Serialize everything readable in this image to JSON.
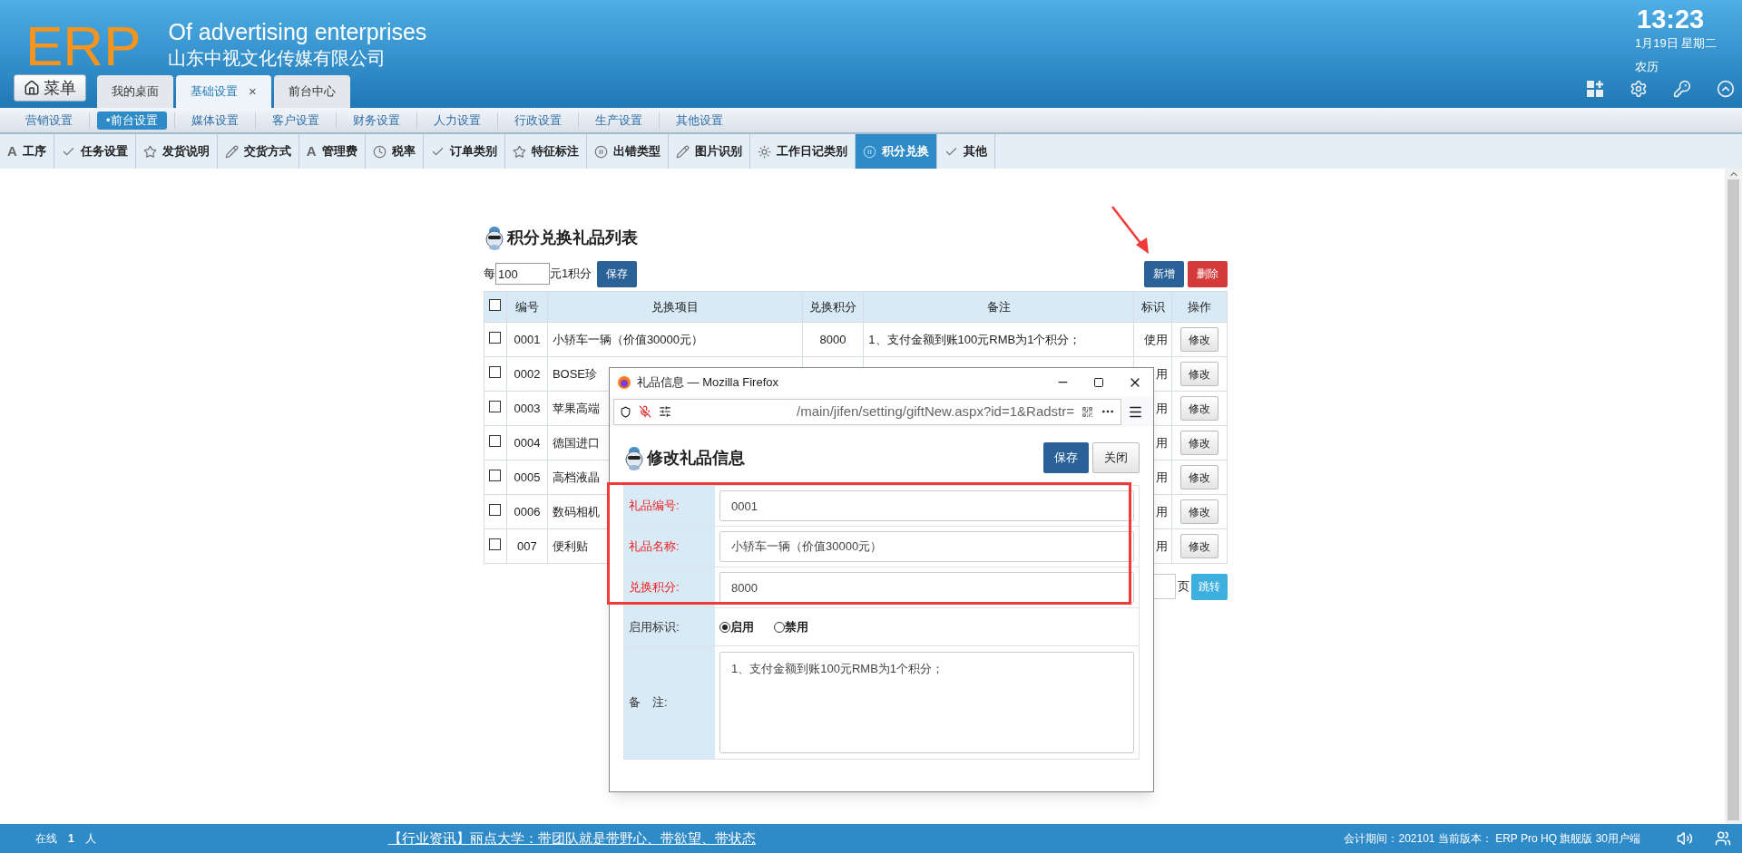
{
  "header": {
    "logo": "ERP",
    "tagline": "Of advertising enterprises",
    "company": "山东中视文化传媒有限公司",
    "menu_button": "菜单",
    "tabs": [
      {
        "label": "我的桌面",
        "selected": false
      },
      {
        "label": "基础设置",
        "selected": true,
        "close": "×"
      },
      {
        "label": "前台中心",
        "selected": false
      }
    ],
    "clock": {
      "time": "13:23",
      "date": "1月19日 星期二",
      "lunar": "农历"
    }
  },
  "category_bar": [
    {
      "label": "营销设置",
      "selected": false
    },
    {
      "label": "•前台设置",
      "selected": true
    },
    {
      "label": "媒体设置",
      "selected": false
    },
    {
      "label": "客户设置",
      "selected": false
    },
    {
      "label": "财务设置",
      "selected": false
    },
    {
      "label": "人力设置",
      "selected": false
    },
    {
      "label": "行政设置",
      "selected": false
    },
    {
      "label": "生产设置",
      "selected": false
    },
    {
      "label": "其他设置",
      "selected": false
    }
  ],
  "toolbar_tabs": [
    {
      "label": "工序",
      "glyph": "A",
      "selected": false
    },
    {
      "label": "任务设置",
      "selected": false
    },
    {
      "label": "发货说明",
      "selected": false
    },
    {
      "label": "交货方式",
      "selected": false
    },
    {
      "label": "管理费",
      "glyph": "A",
      "selected": false
    },
    {
      "label": "税率",
      "selected": false
    },
    {
      "label": "订单类别",
      "selected": false
    },
    {
      "label": "特征标注",
      "selected": false
    },
    {
      "label": "出错类型",
      "selected": false
    },
    {
      "label": "图片识别",
      "selected": false
    },
    {
      "label": "工作日记类别",
      "selected": false
    },
    {
      "label": "积分兑换",
      "selected": true
    },
    {
      "label": "其他",
      "selected": false
    }
  ],
  "page": {
    "title": "积分兑换礼品列表",
    "rate_prefix": "每",
    "rate_value": "100",
    "rate_suffix": "元1积分",
    "save": "保存",
    "add": "新增",
    "delete": "删除",
    "table": {
      "select_all": {
        "checked": false
      },
      "columns": [
        "编号",
        "兑换项目",
        "兑换积分",
        "备注",
        "标识",
        "操作"
      ],
      "rows": [
        {
          "checked": false,
          "code": "0001",
          "name": "小轿车一辆（价值30000元）",
          "points": "8000",
          "note": "1、支付金额到账100元RMB为1个积分；",
          "flag": "使用",
          "action": "修改"
        },
        {
          "checked": false,
          "code": "0002",
          "name": "BOSE珍",
          "flag": "用",
          "action": "修改"
        },
        {
          "checked": false,
          "code": "0003",
          "name": "苹果高端",
          "flag": "用",
          "action": "修改"
        },
        {
          "checked": false,
          "code": "0004",
          "name": "德国进口",
          "flag": "用",
          "action": "修改"
        },
        {
          "checked": false,
          "code": "0005",
          "name": "高档液晶",
          "flag": "用",
          "action": "修改"
        },
        {
          "checked": false,
          "code": "0006",
          "name": "数码相机",
          "flag": "用",
          "action": "修改"
        },
        {
          "checked": false,
          "code": "007",
          "name": "便利贴",
          "flag": "用",
          "action": "修改"
        }
      ]
    },
    "pagination": {
      "page_label": "页",
      "go": "跳转"
    }
  },
  "dialog": {
    "window_title": "礼品信息 — Mozilla Firefox",
    "url": "/main/jifen/setting/giftNew.aspx?id=1&Radstr=",
    "heading": "修改礼品信息",
    "save": "保存",
    "close": "关闭",
    "fields": [
      {
        "label": "礼品编号:",
        "value": "0001",
        "required": true
      },
      {
        "label": "礼品名称:",
        "value": "小轿车一辆（价值30000元）",
        "required": true
      },
      {
        "label": "兑换积分:",
        "value": "8000",
        "required": true
      }
    ],
    "status": {
      "label": "启用标识:",
      "options": [
        {
          "label": "启用",
          "selected": true
        },
        {
          "label": "禁用",
          "selected": false
        }
      ]
    },
    "note": {
      "label": "备　注:",
      "value": "1、支付金额到账100元RMB为1个积分；"
    }
  },
  "footer": {
    "online_label": "在线",
    "online_count": "1",
    "online_unit": "人",
    "news": "【行业资讯】丽点大学：带团队就是带野心、带欲望、带状态",
    "info": "会计期间：202101 当前版本： ERP Pro HQ 旗舰版 30用户端"
  }
}
